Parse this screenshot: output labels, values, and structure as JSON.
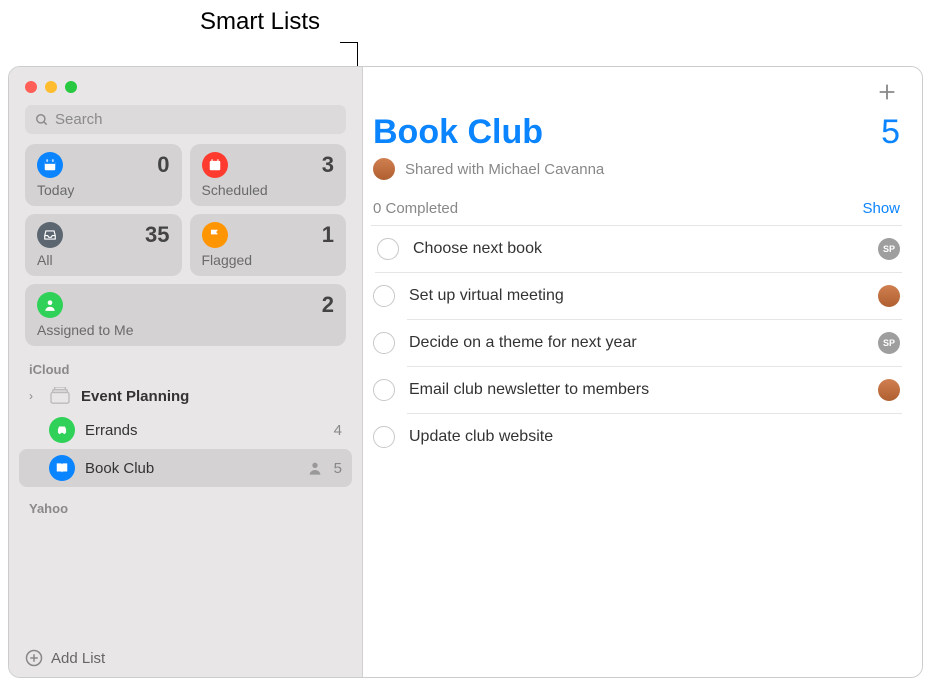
{
  "annotation": {
    "label": "Smart Lists"
  },
  "search": {
    "placeholder": "Search"
  },
  "smart_lists": [
    {
      "id": "today",
      "label": "Today",
      "count": 0,
      "color": "#0a84ff",
      "icon": "calendar"
    },
    {
      "id": "scheduled",
      "label": "Scheduled",
      "count": 3,
      "color": "#ff3b30",
      "icon": "calendar"
    },
    {
      "id": "all",
      "label": "All",
      "count": 35,
      "color": "#5b6670",
      "icon": "tray"
    },
    {
      "id": "flagged",
      "label": "Flagged",
      "count": 1,
      "color": "#ff9500",
      "icon": "flag"
    },
    {
      "id": "assigned",
      "label": "Assigned to Me",
      "count": 2,
      "color": "#30d158",
      "icon": "person",
      "wide": true
    }
  ],
  "sections": [
    {
      "title": "iCloud",
      "lists": [
        {
          "label": "Event Planning",
          "icon": "group",
          "bold": true,
          "expandable": true
        },
        {
          "label": "Errands",
          "icon": "car",
          "color": "#30d158",
          "count": 4
        },
        {
          "label": "Book Club",
          "icon": "book",
          "color": "#0a84ff",
          "count": 5,
          "shared": true,
          "selected": true
        }
      ]
    },
    {
      "title": "Yahoo",
      "lists": []
    }
  ],
  "footer": {
    "add_list": "Add List"
  },
  "main": {
    "title": "Book Club",
    "count": 5,
    "shared_with": "Shared with Michael Cavanna",
    "completed_text": "0 Completed",
    "show_label": "Show",
    "tasks": [
      {
        "label": "Choose next book",
        "assignee": "sp"
      },
      {
        "label": "Set up virtual meeting",
        "assignee": "avatar"
      },
      {
        "label": "Decide on a theme for next year",
        "assignee": "sp"
      },
      {
        "label": "Email club newsletter to members",
        "assignee": "avatar"
      },
      {
        "label": "Update club website",
        "assignee": null
      }
    ],
    "sp_initials": "SP"
  }
}
